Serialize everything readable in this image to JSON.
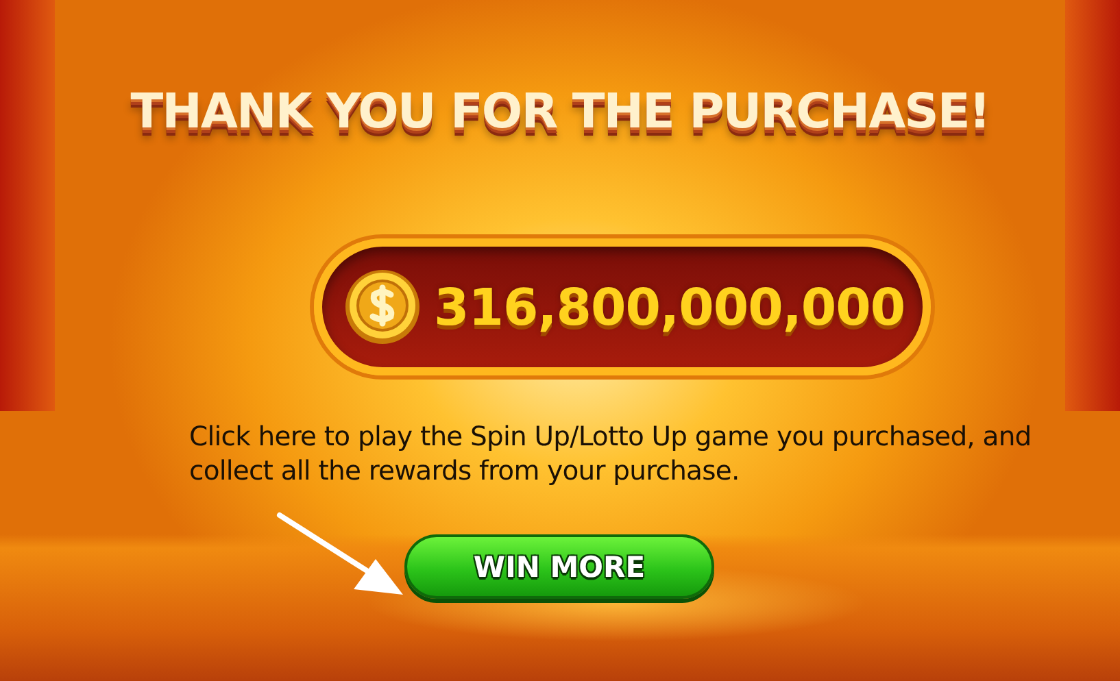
{
  "title": "THANK YOU FOR THE PURCHASE!",
  "amount": "316,800,000,000",
  "message": "Click here to play the Spin Up/Lotto Up game you purchased, and collect all the rewards from your purchase.",
  "button": "WIN MORE"
}
